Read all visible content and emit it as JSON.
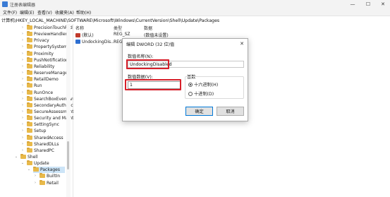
{
  "window": {
    "title": "注册表编辑器",
    "minimize_glyph": "—",
    "maximize_glyph": "☐",
    "close_glyph": "✕"
  },
  "menu": [
    "文件(F)",
    "编辑(E)",
    "查看(V)",
    "收藏夹(A)",
    "帮助(H)"
  ],
  "address": "计算机\\HKEY_LOCAL_MACHINE\\SOFTWARE\\Microsoft\\Windows\\CurrentVersion\\Shell\\Update\\Packages",
  "tree": {
    "items": [
      {
        "label": "PrecisionTouchPad",
        "expanded": false
      },
      {
        "label": "PreviewHandlers",
        "expanded": false
      },
      {
        "label": "Privacy",
        "expanded": false
      },
      {
        "label": "PropertySystem",
        "expanded": false
      },
      {
        "label": "Proximity",
        "expanded": false
      },
      {
        "label": "PushNotifications",
        "expanded": false
      },
      {
        "label": "Reliability",
        "expanded": false
      },
      {
        "label": "ReserveManager",
        "expanded": false
      },
      {
        "label": "RetailDemo",
        "expanded": false
      },
      {
        "label": "Run",
        "expanded": false
      },
      {
        "label": "RunOnce",
        "expanded": false
      },
      {
        "label": "SearchBoxEventArgs",
        "expanded": false
      },
      {
        "label": "SecondaryAuthFactor",
        "expanded": false
      },
      {
        "label": "SecureAssessment",
        "expanded": false
      },
      {
        "label": "Security and Maint",
        "expanded": false
      },
      {
        "label": "SettingSync",
        "expanded": false
      },
      {
        "label": "Setup",
        "expanded": false
      },
      {
        "label": "SharedAccess",
        "expanded": false
      },
      {
        "label": "SharedDLLs",
        "expanded": false
      },
      {
        "label": "SharedPC",
        "expanded": false
      },
      {
        "label": "Shell",
        "expanded": true
      },
      {
        "label": "Update",
        "expanded": true
      },
      {
        "label": "Packages",
        "expanded": true,
        "selected": true
      },
      {
        "label": "BuiltIn",
        "expanded": false
      },
      {
        "label": "Retail",
        "expanded": false
      }
    ]
  },
  "values": {
    "headers": {
      "name": "名称",
      "type": "类型",
      "data": "数据"
    },
    "rows": [
      {
        "name": "(默认)",
        "type": "REG_SZ",
        "data": "(数值未设置)",
        "icon_color": "#c0392b"
      },
      {
        "name": "UndockingDis...",
        "type": "REG",
        "data": "",
        "icon_color": "#2e6fd1"
      }
    ]
  },
  "dialog": {
    "title": "编辑 DWORD (32 位)值",
    "close_glyph": "✕",
    "name_label": "数值名称(N):",
    "name_value": "UndockingDisabled",
    "data_label": "数值数据(V):",
    "data_value": "1",
    "base_label": "基数",
    "base_options": [
      {
        "label": "十六进制(H)",
        "selected": true
      },
      {
        "label": "十进制(D)",
        "selected": false
      }
    ],
    "ok_label": "确定",
    "cancel_label": "取消"
  },
  "colors": {
    "highlight_border": "#d71f2a",
    "selection": "#cce4f7",
    "folder": "#e8b94a"
  }
}
